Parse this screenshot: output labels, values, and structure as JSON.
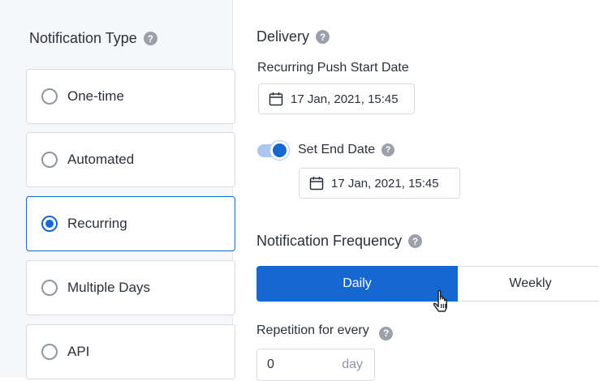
{
  "notification_type": {
    "title": "Notification Type",
    "options": [
      {
        "label": "One-time",
        "selected": false
      },
      {
        "label": "Automated",
        "selected": false
      },
      {
        "label": "Recurring",
        "selected": true
      },
      {
        "label": "Multiple Days",
        "selected": false
      },
      {
        "label": "API",
        "selected": false
      }
    ]
  },
  "delivery": {
    "title": "Delivery",
    "start_date_label": "Recurring Push Start Date",
    "start_date_value": "17 Jan, 2021, 15:45",
    "end_date_toggle": true,
    "end_date_label": "Set End Date",
    "end_date_value": "17 Jan, 2021, 15:45"
  },
  "frequency": {
    "title": "Notification Frequency",
    "options": [
      "Daily",
      "Weekly"
    ],
    "selected": "Daily"
  },
  "repetition": {
    "label": "Repetition for every",
    "value": "0",
    "unit": "day"
  },
  "colors": {
    "accent": "#1767d1",
    "toggle_track": "#a9c7f1",
    "border": "#d7dce2",
    "help_icon": "#9aa1ab"
  },
  "icons": [
    "help-icon",
    "calendar-icon",
    "hand-pointer-cursor"
  ]
}
